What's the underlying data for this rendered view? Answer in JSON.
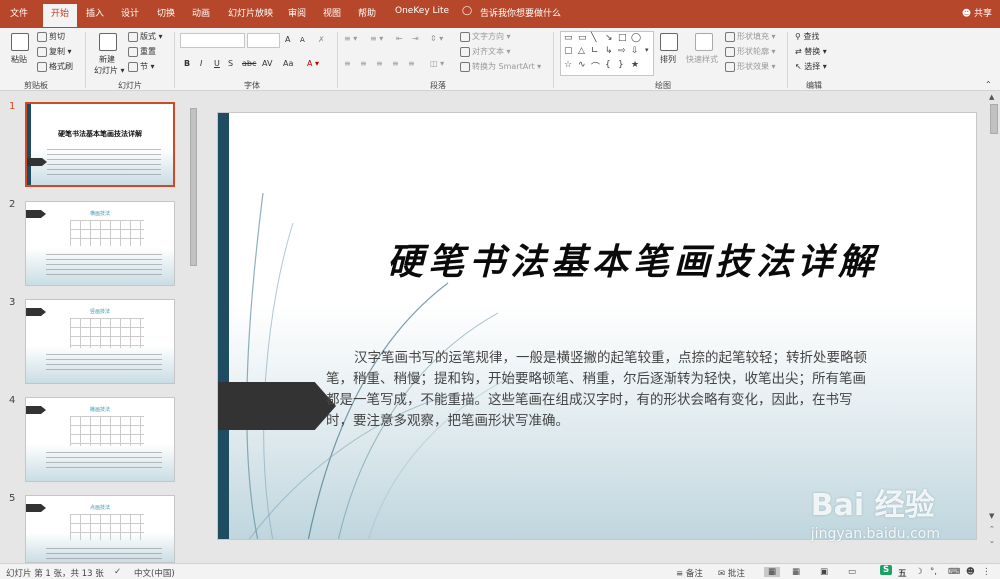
{
  "app": {
    "accent": "#b7472a"
  },
  "menu": [
    "文件",
    "开始",
    "插入",
    "设计",
    "切换",
    "动画",
    "幻灯片放映",
    "审阅",
    "视图",
    "帮助",
    "OneKey Lite"
  ],
  "tell_me": "告诉我你想要做什么",
  "share": "共享",
  "ribbon": {
    "clipboard": {
      "paste": "粘贴",
      "cut": "剪切",
      "copy": "复制",
      "format_painter": "格式刷",
      "label": "剪贴板"
    },
    "slides": {
      "new_slide_1": "新建",
      "new_slide_2": "幻灯片",
      "layout": "版式",
      "reset": "重置",
      "section": "节",
      "label": "幻灯片"
    },
    "font": {
      "label": "字体",
      "b": "B",
      "i": "I",
      "u": "U",
      "s": "S",
      "abc": "abc",
      "av": "AV",
      "aa": "Aa",
      "grow": "A",
      "shrink": "A"
    },
    "paragraph": {
      "label": "段落",
      "text_direction": "文字方向",
      "align_text": "对齐文本",
      "smartart": "转换为 SmartArt"
    },
    "drawing": {
      "label": "绘图",
      "arrange": "排列",
      "quick_styles": "快速样式",
      "shape_fill": "形状填充",
      "shape_outline": "形状轮廓",
      "shape_effects": "形状效果"
    },
    "editing": {
      "label": "编辑",
      "find": "查找",
      "replace": "替换",
      "select": "选择"
    }
  },
  "thumbnails": [
    {
      "num": "1",
      "title": "硬笔书法基本笔画技法详解",
      "selected": true
    },
    {
      "num": "2",
      "subtitle": "横画技法"
    },
    {
      "num": "3",
      "subtitle": "竖画技法"
    },
    {
      "num": "4",
      "subtitle": "撇画技法"
    },
    {
      "num": "5",
      "subtitle": "点画技法"
    }
  ],
  "slide": {
    "title": "硬笔书法基本笔画技法详解",
    "body": "汉字笔画书写的运笔规律，一般是横竖撇的起笔较重，点捺的起笔较轻；转折处要略顿笔，稍重、稍慢；提和钩，开始要略顿笔、稍重，尔后逐渐转为轻快，收笔出尖；所有笔画都是一笔写成，不能重描。这些笔画在组成汉字时，有的形状会略有变化，因此，在书写时，要注意多观察，把笔画形状写准确。"
  },
  "status": {
    "slide_info": "幻灯片 第 1 张，共 13 张",
    "language": "中文(中国)",
    "notes": "备注",
    "comments": "批注",
    "ime": "五"
  },
  "watermark": {
    "brand": "Bai 经验",
    "url": "jingyan.baidu.com"
  }
}
